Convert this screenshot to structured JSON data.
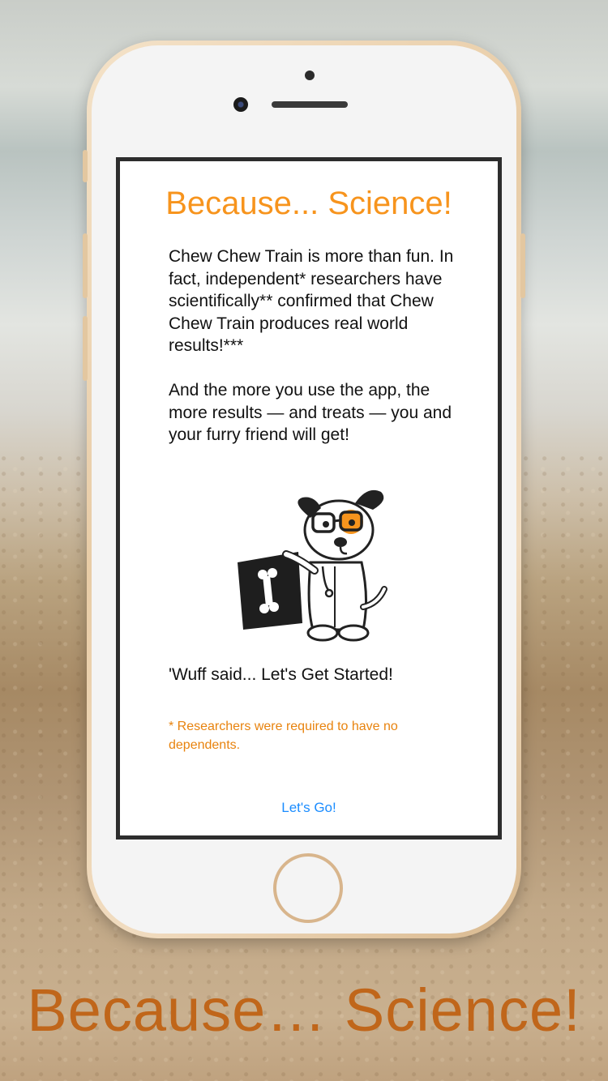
{
  "app": {
    "title": "Because... Science!",
    "paragraph_1": "Chew Chew Train is more than fun. In fact, independent* researchers have scientifically** confirmed that Chew Chew Train produces real world results!***",
    "paragraph_2": "And the more you use the app, the more results — and treats — you and your furry friend will get!",
    "wuff_line": "'Wuff said... Let's Get Started!",
    "footnote": "* Researchers were required to have no dependents.",
    "cta_label": "Let's Go!"
  },
  "illustration": {
    "icon": "scientist-dog-icon",
    "sign_icon": "bone-icon"
  },
  "caption": "Because… Science!",
  "colors": {
    "title_orange": "#f7941d",
    "footnote_orange": "#e8830e",
    "link_blue": "#1a8cff",
    "caption_brown": "#c0661a"
  }
}
